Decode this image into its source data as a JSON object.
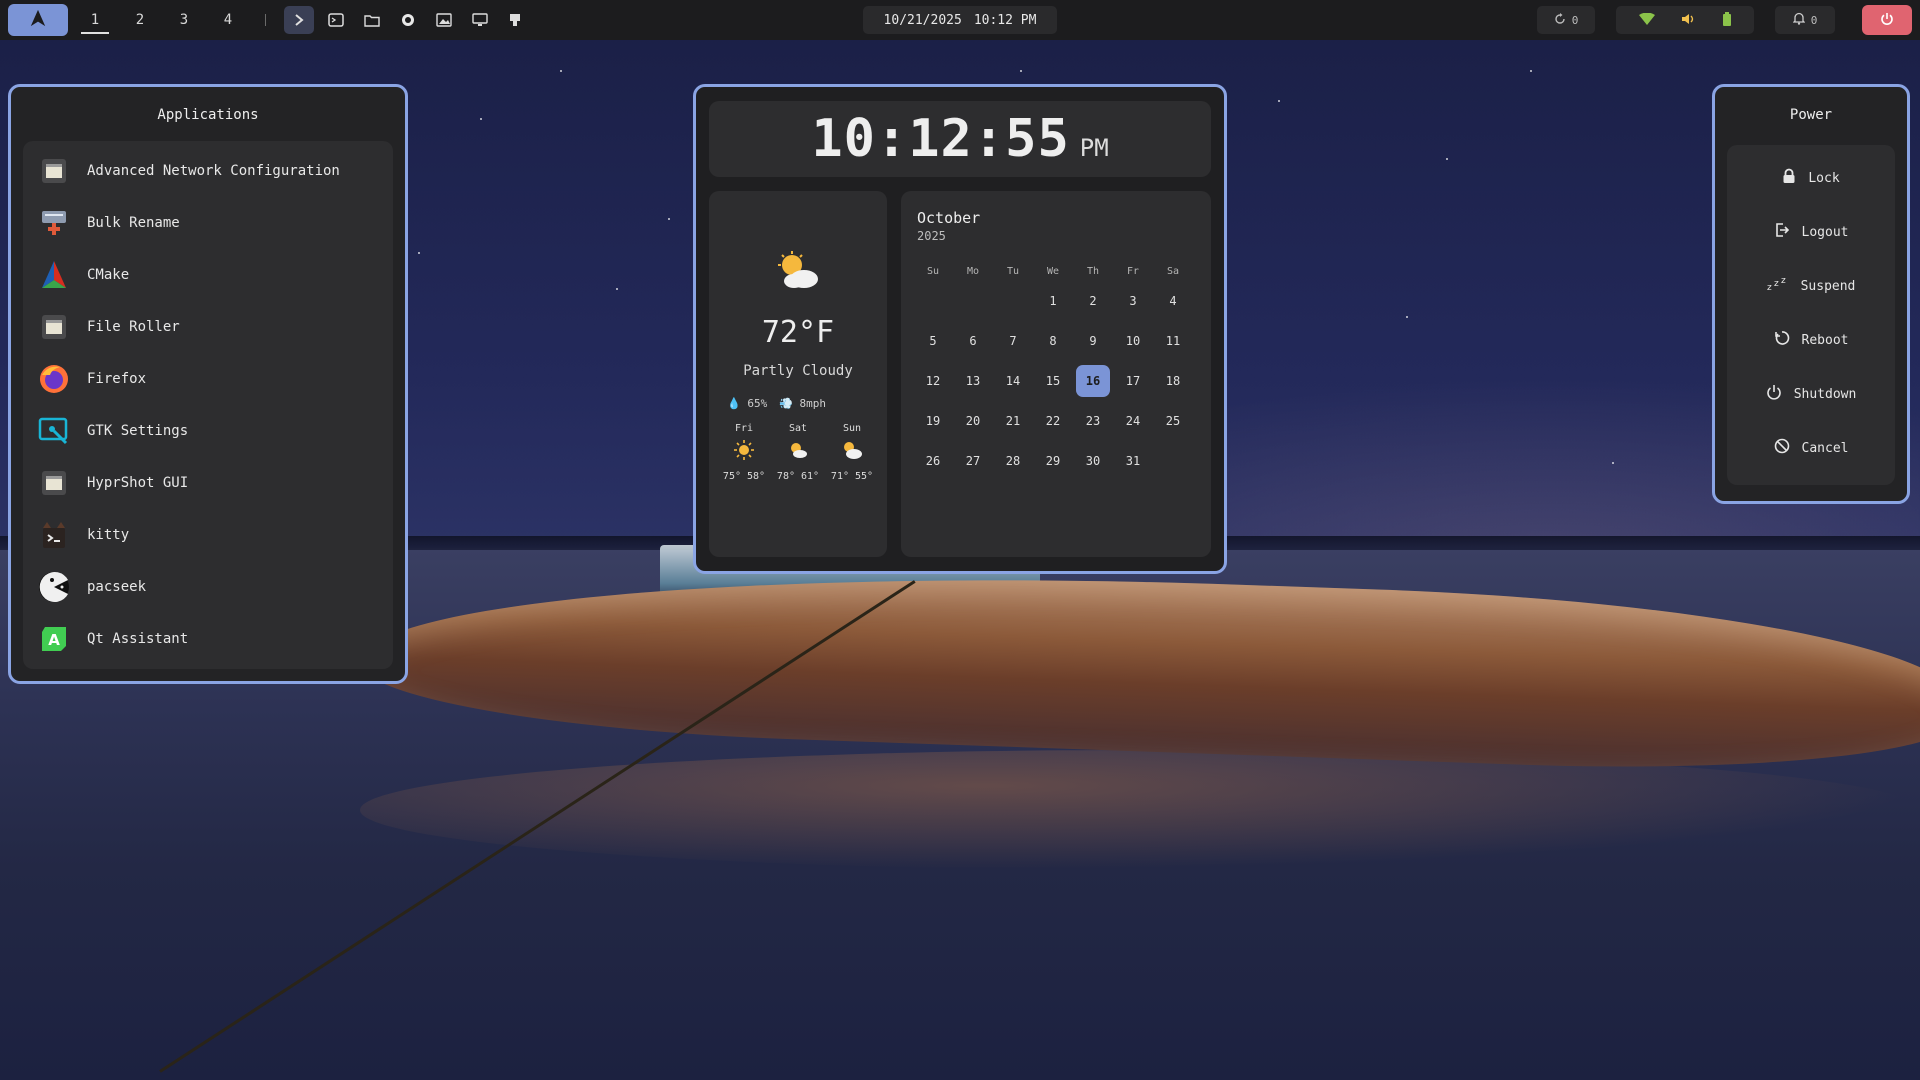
{
  "topbar": {
    "launcher_icon": "arch-logo-icon",
    "workspaces": [
      "1",
      "2",
      "3",
      "4"
    ],
    "active_workspace": "1",
    "date": "10/21/2025",
    "time": "10:12 PM",
    "updates_count": "0",
    "notifications_count": "0",
    "accent": "#7b94d6",
    "power_color": "#e06470"
  },
  "apps_panel": {
    "title": "Applications",
    "items": [
      {
        "label": "Advanced Network Configuration",
        "icon": "window-icon"
      },
      {
        "label": "Bulk Rename",
        "icon": "bulk-rename-icon"
      },
      {
        "label": "CMake",
        "icon": "cmake-icon"
      },
      {
        "label": "File Roller",
        "icon": "window-icon"
      },
      {
        "label": "Firefox",
        "icon": "firefox-icon"
      },
      {
        "label": "GTK Settings",
        "icon": "gtk-settings-icon"
      },
      {
        "label": "HyprShot GUI",
        "icon": "window-icon"
      },
      {
        "label": "kitty",
        "icon": "kitty-icon"
      },
      {
        "label": "pacseek",
        "icon": "pacseek-icon"
      },
      {
        "label": "Qt Assistant",
        "icon": "qt-assistant-icon"
      }
    ]
  },
  "clock": {
    "time": "10:12:55",
    "ampm": "PM"
  },
  "weather": {
    "icon": "partly-cloudy-icon",
    "temp": "72°F",
    "condition": "Partly Cloudy",
    "humidity": "65%",
    "wind": "8mph",
    "forecast": [
      {
        "day": "Fri",
        "icon": "sunny-icon",
        "temps": "75° 58°"
      },
      {
        "day": "Sat",
        "icon": "sun-cloud-icon",
        "temps": "78° 61°"
      },
      {
        "day": "Sun",
        "icon": "partly-cloudy-icon",
        "temps": "71° 55°"
      }
    ]
  },
  "calendar": {
    "month": "October",
    "year": "2025",
    "weekdays": [
      "Su",
      "Mo",
      "Tu",
      "We",
      "Th",
      "Fr",
      "Sa"
    ],
    "weeks": [
      [
        "",
        "",
        "",
        "1",
        "2",
        "3",
        "4"
      ],
      [
        "5",
        "6",
        "7",
        "8",
        "9",
        "10",
        "11"
      ],
      [
        "12",
        "13",
        "14",
        "15",
        "16",
        "17",
        "18"
      ],
      [
        "19",
        "20",
        "21",
        "22",
        "23",
        "24",
        "25"
      ],
      [
        "26",
        "27",
        "28",
        "29",
        "30",
        "31",
        ""
      ]
    ],
    "highlighted_day": "16"
  },
  "power_panel": {
    "title": "Power",
    "items": [
      {
        "label": "Lock",
        "icon": "lock-icon"
      },
      {
        "label": "Logout",
        "icon": "logout-icon"
      },
      {
        "label": "Suspend",
        "icon": "suspend-icon"
      },
      {
        "label": "Reboot",
        "icon": "reboot-icon"
      },
      {
        "label": "Shutdown",
        "icon": "shutdown-icon"
      },
      {
        "label": "Cancel",
        "icon": "cancel-icon"
      }
    ]
  }
}
